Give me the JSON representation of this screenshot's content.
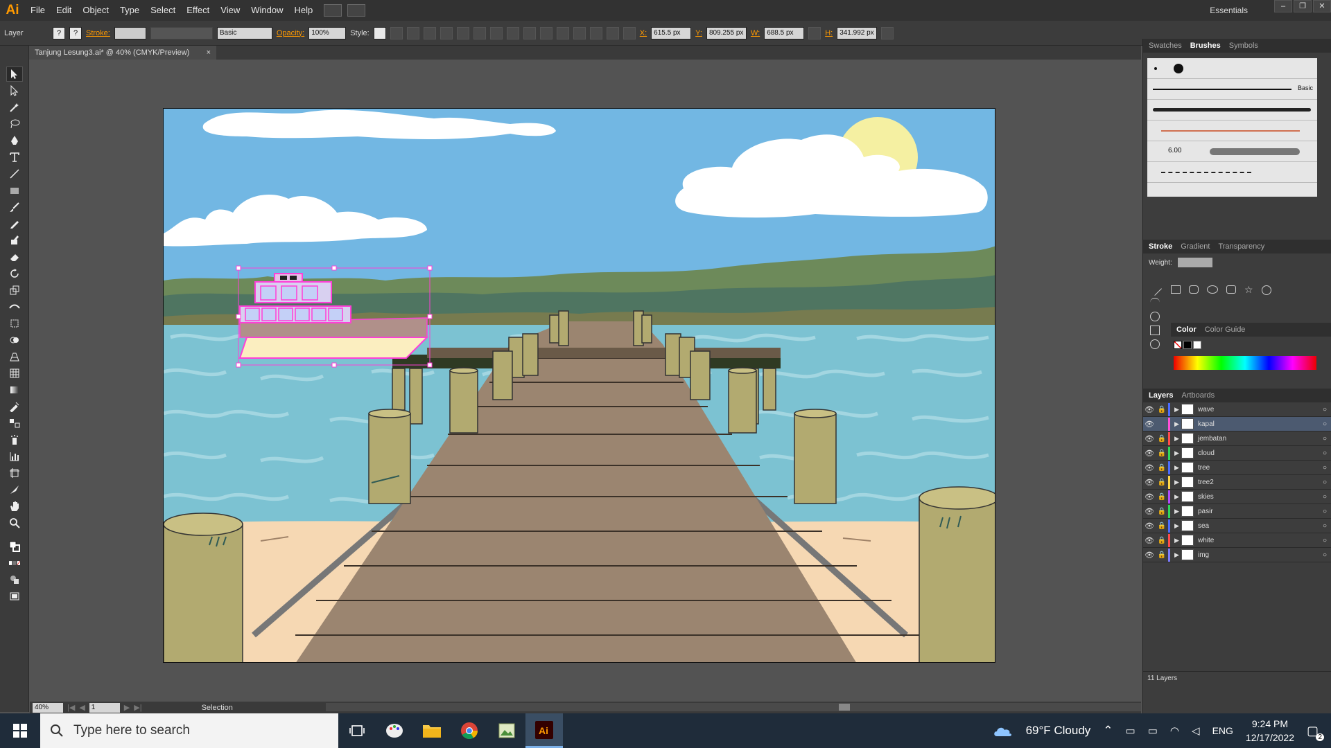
{
  "app": {
    "logo": "Ai",
    "menu": [
      "File",
      "Edit",
      "Object",
      "Type",
      "Select",
      "Effect",
      "View",
      "Window",
      "Help"
    ],
    "workspace": "Essentials"
  },
  "control_bar": {
    "layer_label": "Layer",
    "stroke_label": "Stroke:",
    "brush_style": "Basic",
    "opacity_label": "Opacity:",
    "opacity_value": "100%",
    "style_label": "Style:",
    "x_label": "X:",
    "x_value": "615.5 px",
    "y_label": "Y:",
    "y_value": "809.255 px",
    "w_label": "W:",
    "w_value": "688.5 px",
    "h_label": "H:",
    "h_value": "341.992 px"
  },
  "document": {
    "tab_title": "Tanjung Lesung3.ai* @ 40% (CMYK/Preview)",
    "close": "×"
  },
  "status": {
    "zoom": "40%",
    "page": "1",
    "tool": "Selection"
  },
  "panels": {
    "top_tabs": [
      "Swatches",
      "Brushes",
      "Symbols"
    ],
    "brush_basic_label": "Basic",
    "brush_size": "6.00",
    "stroke_tabs": [
      "Stroke",
      "Gradient",
      "Transparency"
    ],
    "weight_label": "Weight:",
    "color_tabs": [
      "Color",
      "Color Guide"
    ],
    "layer_tabs": [
      "Layers",
      "Artboards"
    ],
    "layer_count": "11 Layers",
    "layers": [
      {
        "name": "wave",
        "color": "#4b6cff",
        "selected": false
      },
      {
        "name": "kapal",
        "color": "#ff4fd8",
        "selected": true
      },
      {
        "name": "jembatan",
        "color": "#ff4b4b",
        "selected": false
      },
      {
        "name": "cloud",
        "color": "#2fd95a",
        "selected": false
      },
      {
        "name": "tree",
        "color": "#4b6cff",
        "selected": false
      },
      {
        "name": "tree2",
        "color": "#ffd84b",
        "selected": false
      },
      {
        "name": "skies",
        "color": "#b24bff",
        "selected": false
      },
      {
        "name": "pasir",
        "color": "#2fd95a",
        "selected": false
      },
      {
        "name": "sea",
        "color": "#4b6cff",
        "selected": false
      },
      {
        "name": "white",
        "color": "#ff4b4b",
        "selected": false
      },
      {
        "name": "img",
        "color": "#7b7bff",
        "selected": false
      }
    ]
  },
  "taskbar": {
    "search_placeholder": "Type here to search",
    "weather": "69°F  Cloudy",
    "lang": "ENG",
    "time": "9:24 PM",
    "date": "12/17/2022",
    "notifications": "2"
  },
  "colors": {
    "sky": "#72b7e3",
    "sea": "#7fc3d4",
    "sand": "#f6d8b3",
    "dock": "#9b8570",
    "post": "#b2aa70",
    "selection": "#ff3fd8"
  }
}
